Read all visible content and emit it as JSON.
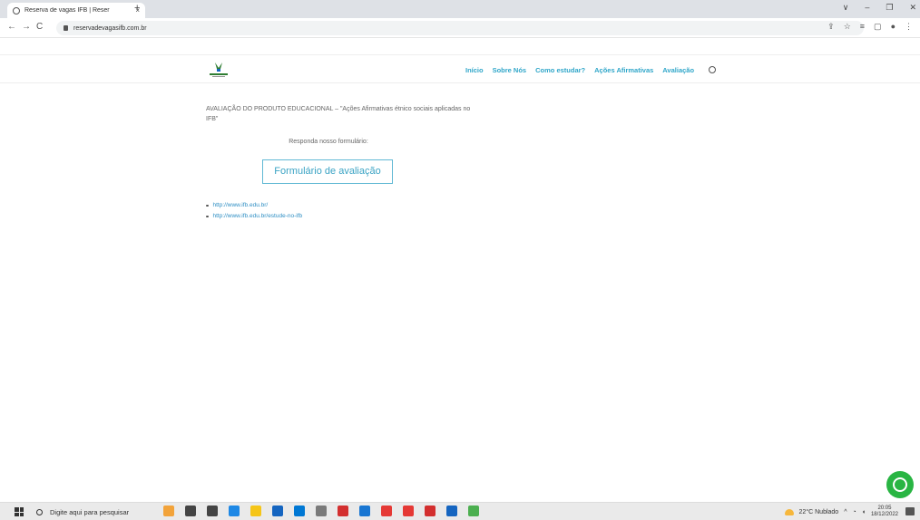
{
  "browser": {
    "tab_title": "Reserva de vagas IFB | Reser",
    "tab_close": "×",
    "new_tab": "+",
    "url": "reservadevagasifb.com.br",
    "back": "←",
    "forward": "→",
    "reload": "C",
    "window_controls": [
      "∨",
      "–",
      "❐",
      "✕"
    ]
  },
  "site": {
    "logo_name": "PROFEPT",
    "nav": [
      "Início",
      "Sobre Nós",
      "Como estudar?",
      "Ações Afirmativas",
      "Avaliação"
    ]
  },
  "main": {
    "heading": "AVALIAÇÃO DO PRODUTO EDUCACIONAL – \"Ações Afirmativas étnico sociais aplicadas no IFB\"",
    "prompt": "Responda nosso formulário:",
    "form_button": "Formulário de avaliação",
    "links": [
      "http://www.ifb.edu.br/",
      "http://www.ifb.edu.br/estude-no-ifb"
    ]
  },
  "taskbar": {
    "search_placeholder": "Digite aqui para pesquisar",
    "weather": "22°C Nublado",
    "time": "20:05",
    "date": "18/12/2022",
    "app_colors": [
      "#f2a33a",
      "#444444",
      "#444444",
      "#1e88e5",
      "#f5c518",
      "#1565c0",
      "#0078d4",
      "#7a7a7a",
      "#d32f2f",
      "#1976d2",
      "#e53935",
      "#e53935",
      "#d32f2f",
      "#1565c0",
      "#4caf50"
    ]
  },
  "colors": {
    "accent": "#2fa6c9",
    "whatsapp": "#29b543"
  }
}
